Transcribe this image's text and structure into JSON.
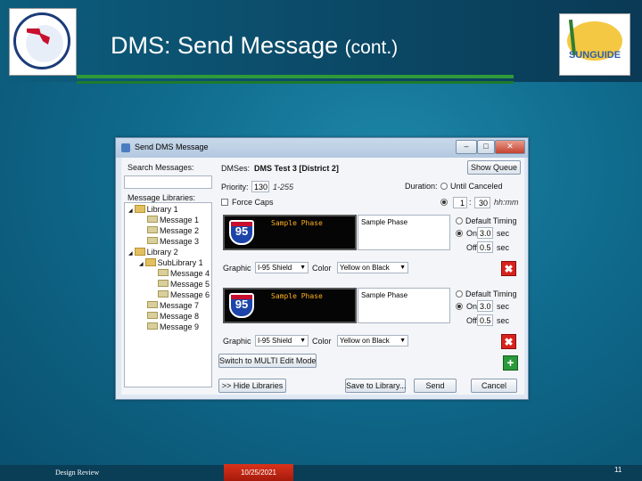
{
  "slide": {
    "title": "DMS: Send Message",
    "title_suffix": "(cont.)",
    "sunguide_text": "SUNGUIDE",
    "footer_left": "Design Review",
    "footer_date": "10/25/2021",
    "slide_number": "11"
  },
  "window": {
    "title": "Send DMS Message",
    "controls": {
      "minimize": "–",
      "maximize": "□",
      "close": "✕"
    },
    "search_label": "Search Messages:",
    "search_value": "",
    "libraries_label": "Message Libraries:",
    "tree": [
      {
        "label": "Library 1",
        "type": "folder",
        "indent": 0,
        "expander": "◢"
      },
      {
        "label": "Message 1",
        "type": "msg",
        "indent": 1
      },
      {
        "label": "Message 2",
        "type": "msg",
        "indent": 1
      },
      {
        "label": "Message 3",
        "type": "msg",
        "indent": 1
      },
      {
        "label": "Library 2",
        "type": "folder",
        "indent": 0,
        "expander": "◢"
      },
      {
        "label": "SubLibrary 1",
        "type": "folder",
        "indent": 1,
        "expander": "◢"
      },
      {
        "label": "Message 4",
        "type": "msg",
        "indent": 2
      },
      {
        "label": "Message 5",
        "type": "msg",
        "indent": 2
      },
      {
        "label": "Message 6",
        "type": "msg",
        "indent": 2
      },
      {
        "label": "Message 7",
        "type": "msg",
        "indent": 1
      },
      {
        "label": "Message 8",
        "type": "msg",
        "indent": 1
      },
      {
        "label": "Message 9",
        "type": "msg",
        "indent": 1
      }
    ],
    "dms_label": "DMSes:",
    "dms_value": "DMS Test 3 [District 2]",
    "show_queue": "Show Queue",
    "priority_label": "Priority:",
    "priority_value": "130",
    "priority_range": "1-255",
    "force_caps": "Force Caps",
    "duration_label": "Duration:",
    "until_canceled": "Until Canceled",
    "duration_hours": "1",
    "duration_minutes": "30",
    "duration_unit": "hh:mm",
    "phases": [
      {
        "led_text": "Sample Phase",
        "shield_text": "95",
        "phase_text": "Sample Phase",
        "default_timing": "Default Timing",
        "on_label": "On",
        "on_value": "3.0",
        "on_unit": "sec",
        "off_label": "Off",
        "off_value": "0.5",
        "off_unit": "sec",
        "graphic_label": "Graphic",
        "graphic_value": "I-95 Shield",
        "color_label": "Color",
        "color_value": "Yellow on Black"
      },
      {
        "led_text": "Sample Phase",
        "shield_text": "95",
        "phase_text": "Sample Phase",
        "default_timing": "Default Timing",
        "on_label": "On",
        "on_value": "3.0",
        "on_unit": "sec",
        "off_label": "Off",
        "off_value": "0.5",
        "off_unit": "sec",
        "graphic_label": "Graphic",
        "graphic_value": "I-95 Shield",
        "color_label": "Color",
        "color_value": "Yellow on Black"
      }
    ],
    "switch_mode": "Switch to MULTI Edit Mode",
    "hide_libraries": ">> Hide Libraries",
    "save_to_library": "Save to Library...",
    "send": "Send",
    "cancel": "Cancel",
    "remove_icon": "✖",
    "add_icon": "+"
  }
}
